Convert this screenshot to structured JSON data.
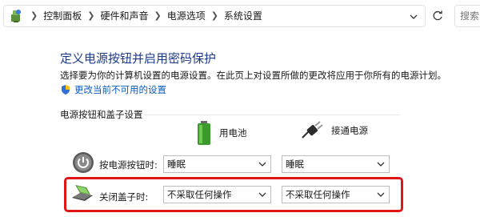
{
  "breadcrumb": {
    "items": [
      "控制面板",
      "硬件和声音",
      "电源选项",
      "系统设置"
    ]
  },
  "search": {
    "placeholder": "搜索"
  },
  "main": {
    "title": "定义电源按钮并启用密码保护",
    "description": "选择要为你的计算机设置的电源设置。在此页上对设置所做的更改将应用于你所有的电源计划。",
    "change_link": "更改当前不可用的设置",
    "section_label": "电源按钮和盖子设置",
    "columns": {
      "battery": "用电池",
      "plugged": "接通电源"
    },
    "rows": [
      {
        "label": "按电源按钮时:",
        "battery": "睡眠",
        "plugged": "睡眠"
      },
      {
        "label": "关闭盖子时:",
        "battery": "不采取任何操作",
        "plugged": "不采取任何操作"
      }
    ]
  },
  "colors": {
    "link": "#0a5cc2",
    "title": "#1e3a8a",
    "highlight": "#e01515"
  }
}
